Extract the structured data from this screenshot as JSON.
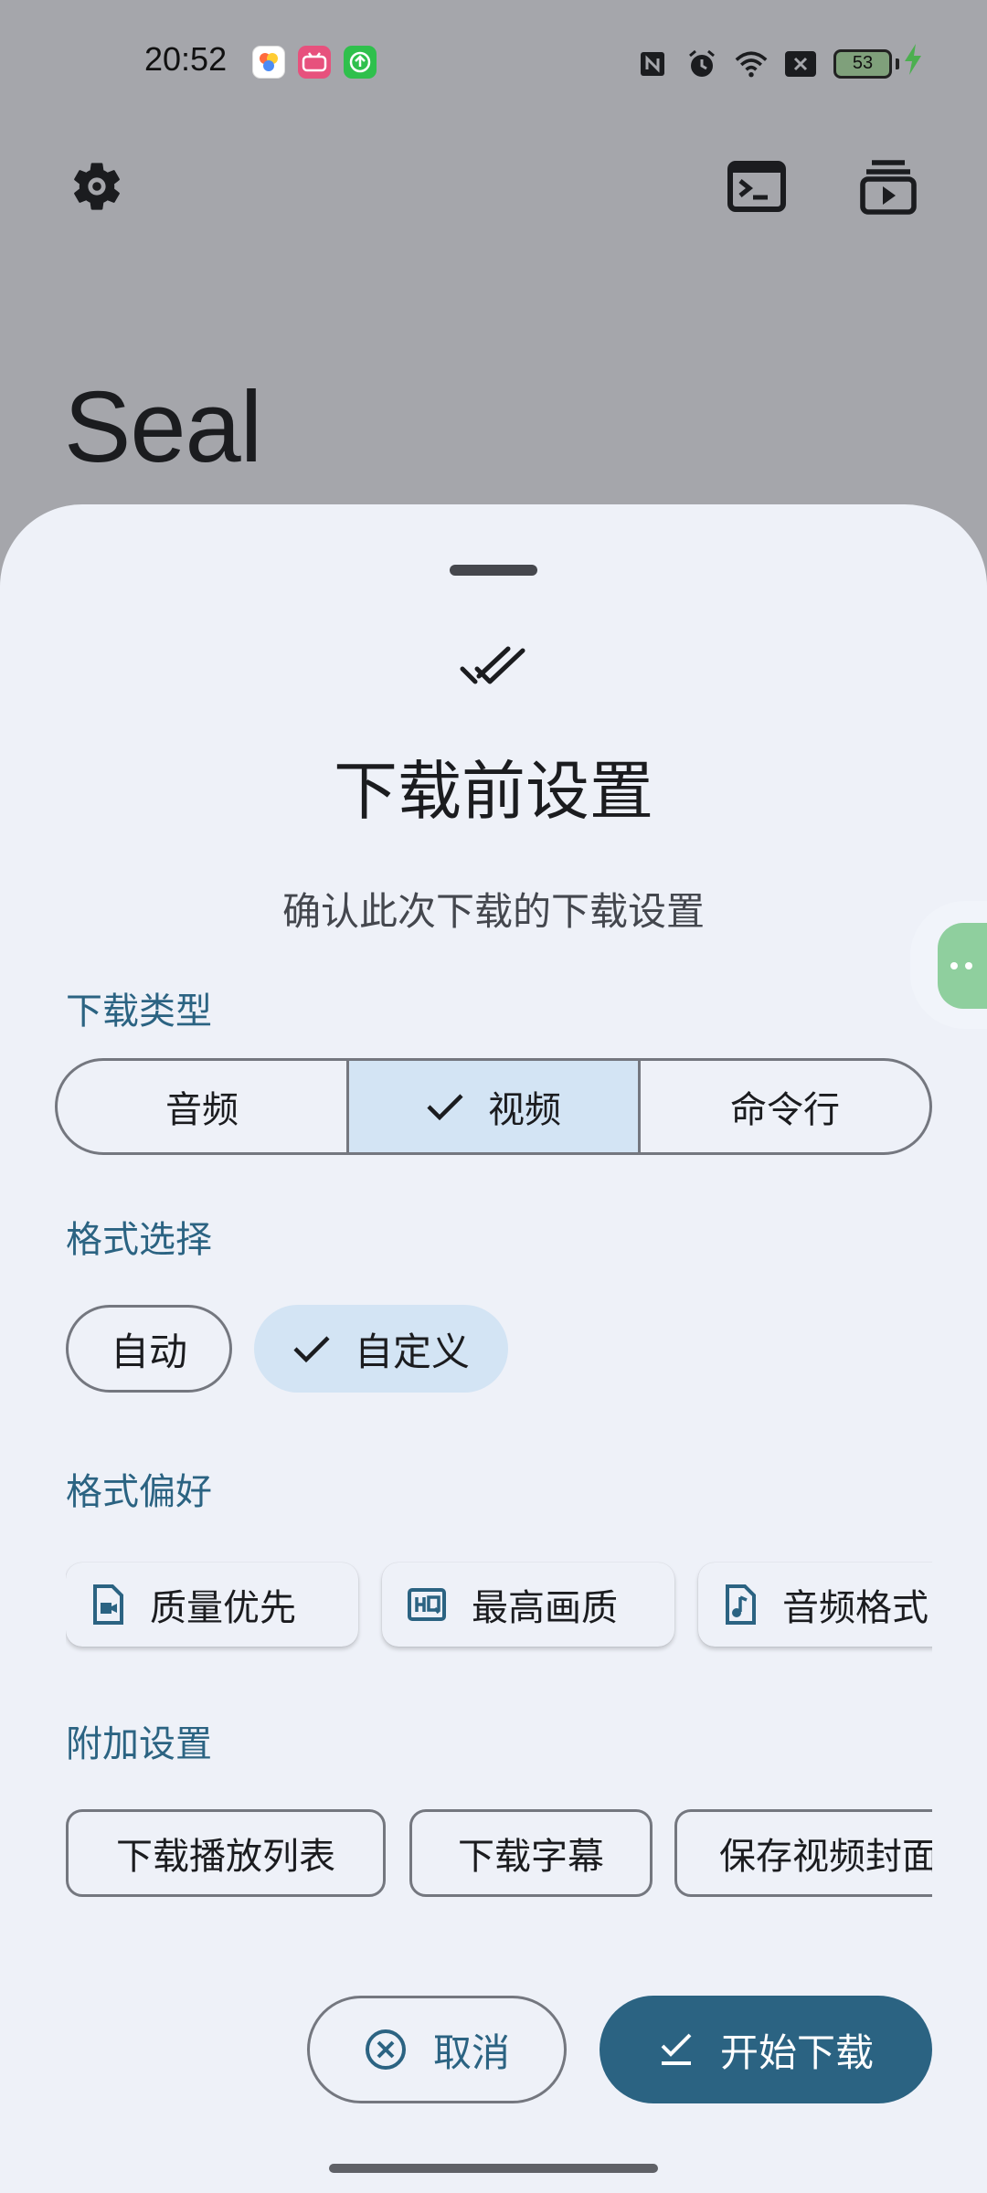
{
  "status_bar": {
    "time": "20:52",
    "battery_level": "53",
    "notification_icons": [
      "kuaishou-icon",
      "bilibili-icon",
      "upload-icon"
    ],
    "system_icons": [
      "nfc-icon",
      "alarm-icon",
      "wifi-icon",
      "sim-off-icon",
      "battery-icon",
      "charging-icon"
    ]
  },
  "app": {
    "title": "Seal"
  },
  "sheet": {
    "title": "下载前设置",
    "subtitle": "确认此次下载的下载设置",
    "download_type": {
      "label": "下载类型",
      "options": [
        "音频",
        "视频",
        "命令行"
      ],
      "selected": "视频"
    },
    "format_select": {
      "label": "格式选择",
      "auto": "自动",
      "custom": "自定义",
      "selected": "自定义"
    },
    "format_pref": {
      "label": "格式偏好",
      "items": [
        "质量优先",
        "最高画质",
        "音频格式"
      ]
    },
    "extra": {
      "label": "附加设置",
      "items": [
        "下载播放列表",
        "下载字幕",
        "保存视频封面"
      ]
    },
    "cancel_label": "取消",
    "start_label": "开始下载"
  },
  "colors": {
    "accent": "#2b6382",
    "selected_bg": "#d3e4f4",
    "sheet_bg": "#eef1f8",
    "scrim": "#a5a6ab"
  }
}
